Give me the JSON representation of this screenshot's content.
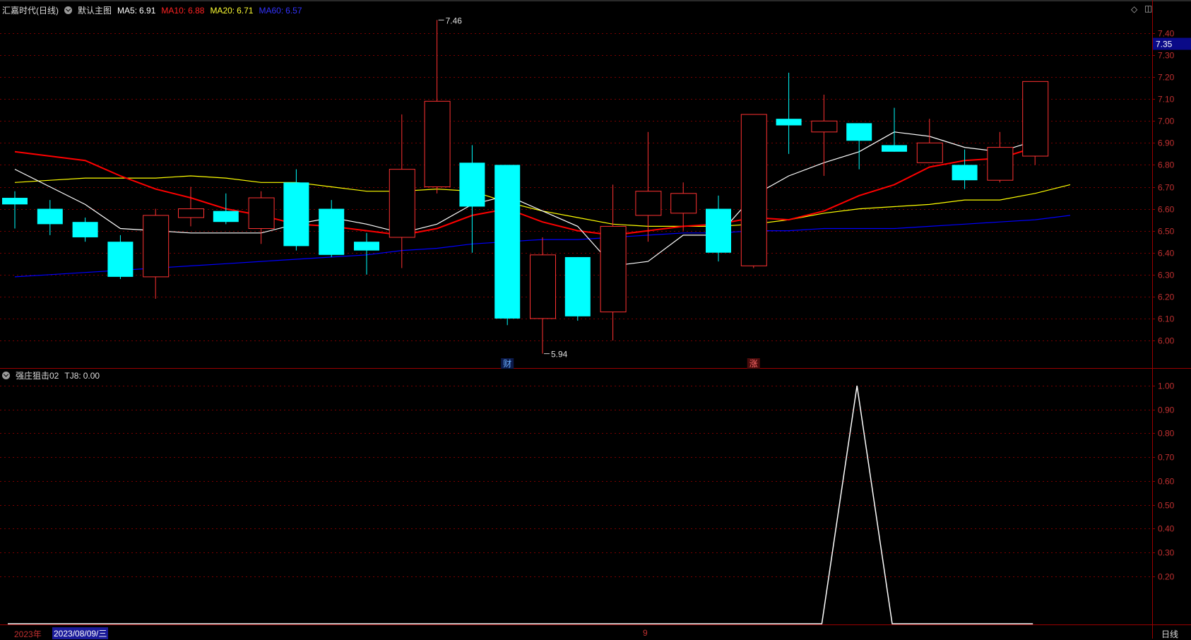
{
  "header": {
    "stock_title": "汇嘉时代(日线)",
    "template_label": "默认主图",
    "ma": [
      {
        "label": "MA5:",
        "value": "6.91",
        "color": "#ffffff"
      },
      {
        "label": "MA10:",
        "value": "6.88",
        "color": "#ff2222"
      },
      {
        "label": "MA20:",
        "value": "6.71",
        "color": "#ffff33"
      },
      {
        "label": "MA60:",
        "value": "6.57",
        "color": "#3333ff"
      }
    ]
  },
  "indicator_header": {
    "name": "强庄狙击02",
    "label": "TJ8:",
    "value": "0.00"
  },
  "price_axis": {
    "current_price": "7.35",
    "ticks": [
      "7.40",
      "7.30",
      "7.20",
      "7.10",
      "7.00",
      "6.90",
      "6.80",
      "6.70",
      "6.60",
      "6.50",
      "6.40",
      "6.30",
      "6.20",
      "6.10",
      "6.00"
    ]
  },
  "indicator_axis": {
    "ticks": [
      "1.00",
      "0.90",
      "0.80",
      "0.70",
      "0.60",
      "0.50",
      "0.40",
      "0.30",
      "0.20"
    ]
  },
  "annotations": {
    "high_label": "7.46",
    "low_label": "5.94",
    "marker_cai": "财",
    "marker_zhang": "涨"
  },
  "time_axis": {
    "year": "2023年",
    "cursor_date": "2023/08/09/三",
    "month": "9",
    "period_button": "日线"
  },
  "colors": {
    "up": "#ff3232",
    "down": "#00ffff",
    "ma5": "#ffffff",
    "ma10": "#ff0000",
    "ma20": "#ffff00",
    "ma60": "#0000ff",
    "grid": "#7a0000",
    "axis_text": "#c03030"
  },
  "icons": {
    "collapse": "diamond-icon",
    "options": "panel-icon"
  },
  "chart_data": [
    {
      "type": "candlestick",
      "ylim": [
        5.86,
        7.48
      ],
      "candles": [
        {
          "o": 6.65,
          "h": 6.68,
          "l": 6.51,
          "c": 6.62
        },
        {
          "o": 6.6,
          "h": 6.64,
          "l": 6.48,
          "c": 6.53
        },
        {
          "o": 6.54,
          "h": 6.56,
          "l": 6.45,
          "c": 6.47
        },
        {
          "o": 6.45,
          "h": 6.48,
          "l": 6.28,
          "c": 6.29
        },
        {
          "o": 6.29,
          "h": 6.6,
          "l": 6.19,
          "c": 6.57
        },
        {
          "o": 6.56,
          "h": 6.7,
          "l": 6.52,
          "c": 6.6
        },
        {
          "o": 6.59,
          "h": 6.67,
          "l": 6.53,
          "c": 6.54
        },
        {
          "o": 6.51,
          "h": 6.68,
          "l": 6.44,
          "c": 6.65
        },
        {
          "o": 6.72,
          "h": 6.78,
          "l": 6.41,
          "c": 6.43
        },
        {
          "o": 6.6,
          "h": 6.64,
          "l": 6.38,
          "c": 6.39
        },
        {
          "o": 6.45,
          "h": 6.49,
          "l": 6.3,
          "c": 6.41
        },
        {
          "o": 6.47,
          "h": 7.03,
          "l": 6.33,
          "c": 6.78
        },
        {
          "o": 6.7,
          "h": 7.46,
          "l": 6.67,
          "c": 7.09
        },
        {
          "o": 6.81,
          "h": 6.89,
          "l": 6.4,
          "c": 6.61
        },
        {
          "o": 6.8,
          "h": 6.8,
          "l": 6.07,
          "c": 6.1
        },
        {
          "o": 6.1,
          "h": 6.47,
          "l": 5.94,
          "c": 6.39
        },
        {
          "o": 6.38,
          "h": 6.38,
          "l": 6.09,
          "c": 6.11
        },
        {
          "o": 6.13,
          "h": 6.71,
          "l": 6.0,
          "c": 6.52
        },
        {
          "o": 6.57,
          "h": 6.95,
          "l": 6.45,
          "c": 6.68
        },
        {
          "o": 6.58,
          "h": 6.72,
          "l": 6.5,
          "c": 6.67
        },
        {
          "o": 6.6,
          "h": 6.66,
          "l": 6.36,
          "c": 6.4
        },
        {
          "o": 6.34,
          "h": 7.03,
          "l": 6.33,
          "c": 7.03
        },
        {
          "o": 7.01,
          "h": 7.22,
          "l": 6.85,
          "c": 6.98
        },
        {
          "o": 6.95,
          "h": 7.12,
          "l": 6.75,
          "c": 7.0
        },
        {
          "o": 6.99,
          "h": 6.99,
          "l": 6.78,
          "c": 6.91
        },
        {
          "o": 6.89,
          "h": 7.06,
          "l": 6.86,
          "c": 6.86
        },
        {
          "o": 6.81,
          "h": 7.01,
          "l": 6.81,
          "c": 6.9
        },
        {
          "o": 6.8,
          "h": 6.87,
          "l": 6.69,
          "c": 6.73
        },
        {
          "o": 6.73,
          "h": 6.95,
          "l": 6.72,
          "c": 6.88
        },
        {
          "o": 6.84,
          "h": 7.18,
          "l": 6.8,
          "c": 7.18
        }
      ],
      "ma5": [
        6.78,
        6.7,
        6.62,
        6.51,
        6.5,
        6.49,
        6.49,
        6.49,
        6.53,
        6.56,
        6.53,
        6.49,
        6.53,
        6.62,
        6.66,
        6.59,
        6.52,
        6.34,
        6.36,
        6.48,
        6.48,
        6.66,
        6.75,
        6.81,
        6.86,
        6.95,
        6.93,
        6.88,
        6.86,
        6.91
      ],
      "ma10": [
        6.86,
        6.84,
        6.82,
        6.75,
        6.69,
        6.65,
        6.6,
        6.57,
        6.53,
        6.52,
        6.5,
        6.48,
        6.51,
        6.57,
        6.6,
        6.54,
        6.5,
        6.48,
        6.5,
        6.52,
        6.53,
        6.56,
        6.55,
        6.59,
        6.66,
        6.71,
        6.79,
        6.82,
        6.83,
        6.88
      ],
      "ma20": [
        6.72,
        6.73,
        6.74,
        6.74,
        6.74,
        6.75,
        6.74,
        6.72,
        6.72,
        6.7,
        6.68,
        6.68,
        6.69,
        6.68,
        6.63,
        6.59,
        6.56,
        6.53,
        6.52,
        6.52,
        6.52,
        6.53,
        6.55,
        6.58,
        6.6,
        6.61,
        6.62,
        6.64,
        6.64,
        6.67,
        6.71
      ],
      "ma60": [
        6.29,
        6.3,
        6.31,
        6.32,
        6.33,
        6.34,
        6.35,
        6.36,
        6.37,
        6.38,
        6.39,
        6.41,
        6.42,
        6.44,
        6.45,
        6.46,
        6.46,
        6.47,
        6.48,
        6.49,
        6.49,
        6.5,
        6.5,
        6.51,
        6.51,
        6.51,
        6.52,
        6.53,
        6.54,
        6.55,
        6.57
      ]
    },
    {
      "type": "line",
      "name": "TJ8",
      "ylim": [
        0,
        1.0
      ],
      "values": [
        0,
        0,
        0,
        0,
        0,
        0,
        0,
        0,
        0,
        0,
        0,
        0,
        0,
        0,
        0,
        0,
        0,
        0,
        0,
        0,
        0,
        0,
        0,
        0,
        1,
        0,
        0,
        0,
        0,
        0
      ]
    }
  ]
}
